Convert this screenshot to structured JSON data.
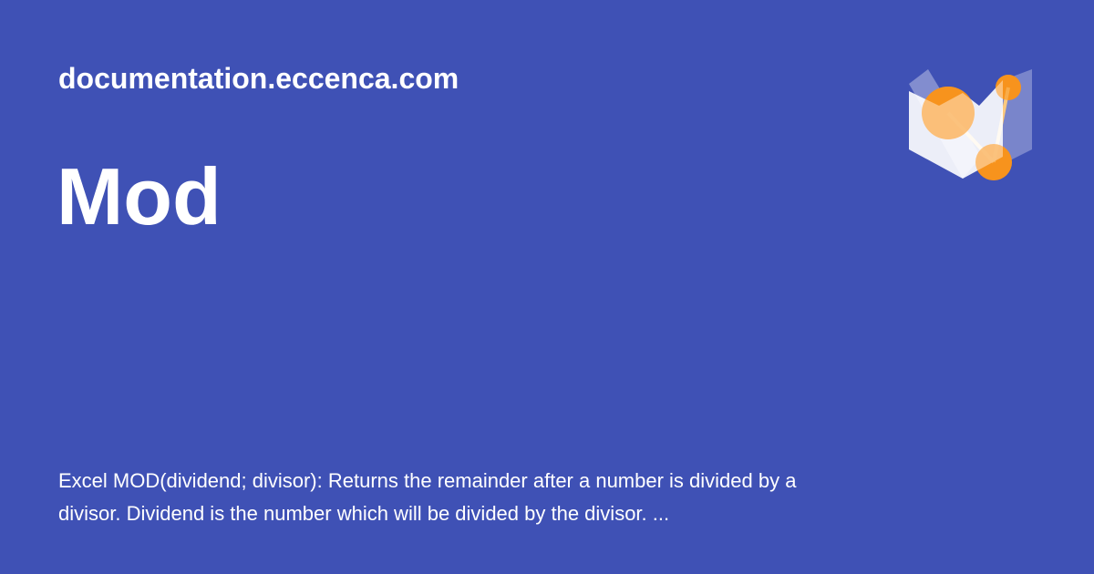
{
  "site": {
    "domain": "documentation.eccenca.com"
  },
  "page": {
    "title": "Mod",
    "description": "Excel MOD(dividend; divisor): Returns the remainder after a number is divided by a divisor. Dividend is the number which will be divided by the divisor. ..."
  },
  "logo": {
    "icon": "material-logo-icon",
    "colors": {
      "background": "#3f51b5",
      "orange": "#f7931e",
      "light_orange": "#fbc97e",
      "white": "#ffffff"
    }
  }
}
